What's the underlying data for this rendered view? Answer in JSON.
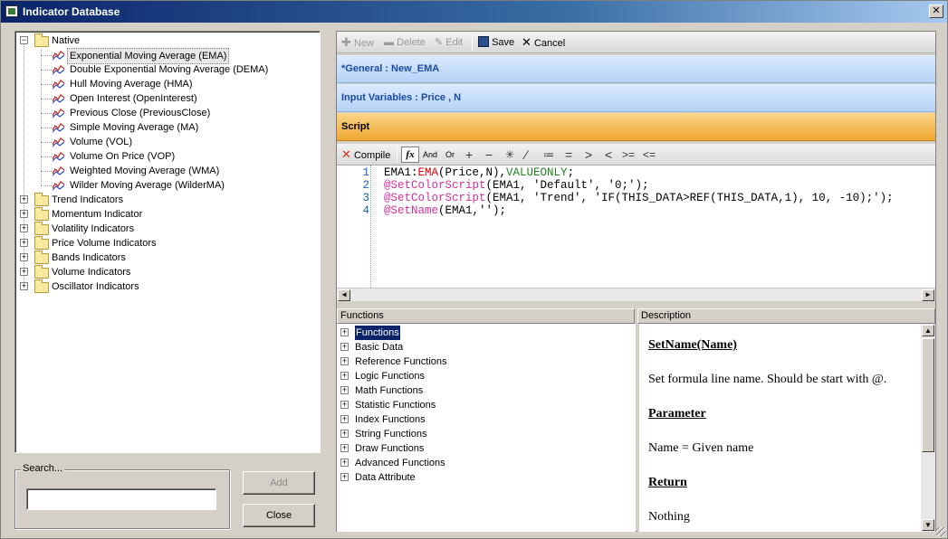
{
  "window": {
    "title": "Indicator Database",
    "close_label": "✕"
  },
  "tree": {
    "root": {
      "label": "Native",
      "expanded": true
    },
    "native_items": [
      "Exponential Moving Average (EMA)",
      "Double Exponential Moving Average (DEMA)",
      "Hull Moving Average (HMA)",
      "Open Interest (OpenInterest)",
      "Previous Close (PreviousClose)",
      "Simple Moving Average (MA)",
      "Volume (VOL)",
      "Volume On Price (VOP)",
      "Weighted Moving Average (WMA)",
      "Wilder Moving Average (WilderMA)"
    ],
    "selected_index": 0,
    "groups": [
      "Trend Indicators",
      "Momentum Indicator",
      "Volatility Indicators",
      "Price Volume Indicators",
      "Bands Indicators",
      "Volume Indicators",
      "Oscillator Indicators"
    ]
  },
  "search": {
    "label": "Search...",
    "value": ""
  },
  "buttons": {
    "add": "Add",
    "close": "Close"
  },
  "toolbar": {
    "new": "New",
    "delete": "Delete",
    "edit": "Edit",
    "save": "Save",
    "cancel": "Cancel"
  },
  "sections": {
    "general": "*General : New_EMA",
    "input_variables": "Input Variables : Price , N",
    "script": "Script"
  },
  "script_toolbar": {
    "compile": "Compile",
    "fx": "fx",
    "and": "And",
    "or": "Or",
    "ops": [
      "+",
      "−",
      "✳",
      "∕",
      "≔",
      "=",
      ">",
      "<",
      ">=",
      "<="
    ]
  },
  "code": {
    "line_numbers": [
      "1",
      "2",
      "3",
      "4"
    ],
    "lines": [
      {
        "a": "EMA1:",
        "b": "EMA",
        "c": "(Price,N),",
        "d": "VALUEONLY",
        "e": ";"
      },
      {
        "a": "@SetColorScript",
        "b": "(EMA1, 'Default', '0;');"
      },
      {
        "a": "@SetColorScript",
        "b": "(EMA1, 'Trend', 'IF(THIS_DATA>REF(THIS_DATA,1), 10, -10);');"
      },
      {
        "a": "@SetName",
        "b": "(EMA1,'');"
      }
    ]
  },
  "functions": {
    "header": "Functions",
    "items": [
      "Functions",
      "Basic Data",
      "Reference Functions",
      "Logic Functions",
      "Math Functions",
      "Statistic Functions",
      "Index Functions",
      "String Functions",
      "Draw Functions",
      "Advanced Functions",
      "Data Attribute"
    ]
  },
  "description": {
    "header": "Description",
    "title": "SetName(Name)",
    "text": "Set formula line name. Should be start with @.",
    "param_heading": "Parameter",
    "param_text": "Name = Given name",
    "return_heading": "Return",
    "return_text": "Nothing"
  }
}
